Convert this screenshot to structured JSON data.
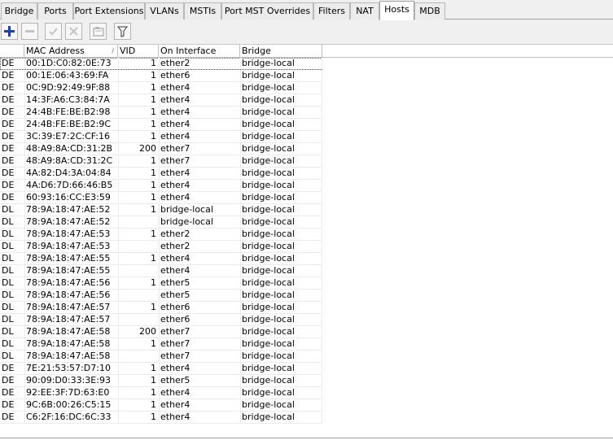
{
  "tabs": [
    {
      "label": "Bridge",
      "active": false
    },
    {
      "label": "Ports",
      "active": false
    },
    {
      "label": "Port Extensions",
      "active": false
    },
    {
      "label": "VLANs",
      "active": false
    },
    {
      "label": "MSTIs",
      "active": false
    },
    {
      "label": "Port MST Overrides",
      "active": false
    },
    {
      "label": "Filters",
      "active": false
    },
    {
      "label": "NAT",
      "active": false
    },
    {
      "label": "Hosts",
      "active": true
    },
    {
      "label": "MDB",
      "active": false
    }
  ],
  "toolbar": {
    "buttons": [
      {
        "icon": "add-icon",
        "enabled": true,
        "color": "#1f3fb0"
      },
      {
        "icon": "remove-icon",
        "enabled": false
      },
      {
        "icon": "enable-check-icon",
        "enabled": false
      },
      {
        "icon": "disable-x-icon",
        "enabled": false
      },
      {
        "icon": "comment-icon",
        "enabled": false
      },
      {
        "icon": "filter-icon",
        "enabled": true
      }
    ]
  },
  "table": {
    "columns": [
      "",
      "MAC Address",
      "VID",
      "On Interface",
      "Bridge"
    ],
    "sorted_column": "MAC Address",
    "rows": [
      {
        "flags": "DE",
        "mac": "00:1D:C0:82:0E:73",
        "vid": "1",
        "iface": "ether2",
        "bridge": "bridge-local"
      },
      {
        "flags": "DE",
        "mac": "00:1E:06:43:69:FA",
        "vid": "1",
        "iface": "ether6",
        "bridge": "bridge-local"
      },
      {
        "flags": "DE",
        "mac": "0C:9D:92:49:9F:88",
        "vid": "1",
        "iface": "ether4",
        "bridge": "bridge-local"
      },
      {
        "flags": "DE",
        "mac": "14:3F:A6:C3:84:7A",
        "vid": "1",
        "iface": "ether4",
        "bridge": "bridge-local"
      },
      {
        "flags": "DE",
        "mac": "24:4B:FE:BE:B2:98",
        "vid": "1",
        "iface": "ether4",
        "bridge": "bridge-local"
      },
      {
        "flags": "DE",
        "mac": "24:4B:FE:BE:B2:9C",
        "vid": "1",
        "iface": "ether4",
        "bridge": "bridge-local"
      },
      {
        "flags": "DE",
        "mac": "3C:39:E7:2C:CF:16",
        "vid": "1",
        "iface": "ether4",
        "bridge": "bridge-local"
      },
      {
        "flags": "DE",
        "mac": "48:A9:8A:CD:31:2B",
        "vid": "200",
        "iface": "ether7",
        "bridge": "bridge-local"
      },
      {
        "flags": "DE",
        "mac": "48:A9:8A:CD:31:2C",
        "vid": "1",
        "iface": "ether7",
        "bridge": "bridge-local"
      },
      {
        "flags": "DE",
        "mac": "4A:82:D4:3A:04:84",
        "vid": "1",
        "iface": "ether4",
        "bridge": "bridge-local"
      },
      {
        "flags": "DE",
        "mac": "4A:D6:7D:66:46:B5",
        "vid": "1",
        "iface": "ether4",
        "bridge": "bridge-local"
      },
      {
        "flags": "DE",
        "mac": "60:93:16:CC:E3:59",
        "vid": "1",
        "iface": "ether4",
        "bridge": "bridge-local"
      },
      {
        "flags": "DL",
        "mac": "78:9A:18:47:AE:52",
        "vid": "1",
        "iface": "bridge-local",
        "bridge": "bridge-local"
      },
      {
        "flags": "DL",
        "mac": "78:9A:18:47:AE:52",
        "vid": "",
        "iface": "bridge-local",
        "bridge": "bridge-local"
      },
      {
        "flags": "DL",
        "mac": "78:9A:18:47:AE:53",
        "vid": "1",
        "iface": "ether2",
        "bridge": "bridge-local"
      },
      {
        "flags": "DL",
        "mac": "78:9A:18:47:AE:53",
        "vid": "",
        "iface": "ether2",
        "bridge": "bridge-local"
      },
      {
        "flags": "DL",
        "mac": "78:9A:18:47:AE:55",
        "vid": "1",
        "iface": "ether4",
        "bridge": "bridge-local"
      },
      {
        "flags": "DL",
        "mac": "78:9A:18:47:AE:55",
        "vid": "",
        "iface": "ether4",
        "bridge": "bridge-local"
      },
      {
        "flags": "DL",
        "mac": "78:9A:18:47:AE:56",
        "vid": "1",
        "iface": "ether5",
        "bridge": "bridge-local"
      },
      {
        "flags": "DL",
        "mac": "78:9A:18:47:AE:56",
        "vid": "",
        "iface": "ether5",
        "bridge": "bridge-local"
      },
      {
        "flags": "DL",
        "mac": "78:9A:18:47:AE:57",
        "vid": "1",
        "iface": "ether6",
        "bridge": "bridge-local"
      },
      {
        "flags": "DL",
        "mac": "78:9A:18:47:AE:57",
        "vid": "",
        "iface": "ether6",
        "bridge": "bridge-local"
      },
      {
        "flags": "DL",
        "mac": "78:9A:18:47:AE:58",
        "vid": "200",
        "iface": "ether7",
        "bridge": "bridge-local"
      },
      {
        "flags": "DL",
        "mac": "78:9A:18:47:AE:58",
        "vid": "1",
        "iface": "ether7",
        "bridge": "bridge-local"
      },
      {
        "flags": "DL",
        "mac": "78:9A:18:47:AE:58",
        "vid": "",
        "iface": "ether7",
        "bridge": "bridge-local"
      },
      {
        "flags": "DE",
        "mac": "7E:21:53:57:D7:10",
        "vid": "1",
        "iface": "ether4",
        "bridge": "bridge-local"
      },
      {
        "flags": "DE",
        "mac": "90:09:D0:33:3E:93",
        "vid": "1",
        "iface": "ether5",
        "bridge": "bridge-local"
      },
      {
        "flags": "DE",
        "mac": "92:EE:3F:7D:63:E0",
        "vid": "1",
        "iface": "ether4",
        "bridge": "bridge-local"
      },
      {
        "flags": "DE",
        "mac": "9C:6B:00:26:C5:15",
        "vid": "1",
        "iface": "ether4",
        "bridge": "bridge-local"
      },
      {
        "flags": "DE",
        "mac": "C6:2F:16:DC:6C:33",
        "vid": "1",
        "iface": "ether4",
        "bridge": "bridge-local"
      }
    ]
  }
}
